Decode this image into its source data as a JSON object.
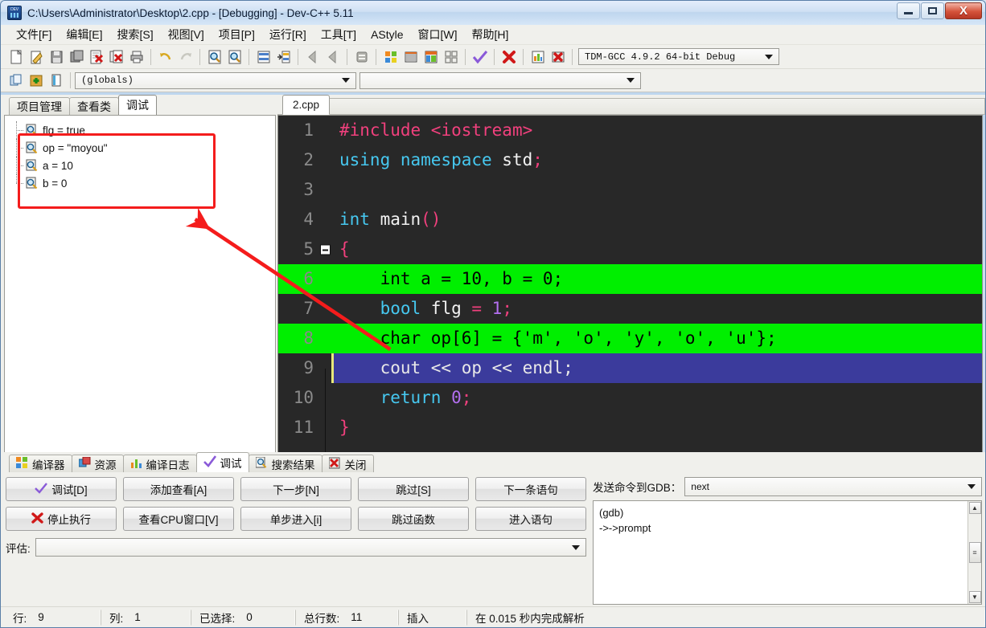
{
  "window": {
    "title": "C:\\Users\\Administrator\\Desktop\\2.cpp - [Debugging] - Dev-C++ 5.11",
    "minimize_label": "",
    "maximize_label": "",
    "close_label": "X"
  },
  "menubar": {
    "items": [
      {
        "label": "文件[F]"
      },
      {
        "label": "编辑[E]"
      },
      {
        "label": "搜索[S]"
      },
      {
        "label": "视图[V]"
      },
      {
        "label": "项目[P]"
      },
      {
        "label": "运行[R]"
      },
      {
        "label": "工具[T]"
      },
      {
        "label": "AStyle"
      },
      {
        "label": "窗口[W]"
      },
      {
        "label": "帮助[H]"
      }
    ]
  },
  "toolbar": {
    "compiler_combo": "TDM-GCC 4.9.2 64-bit Debug",
    "scope_combo": "(globals)",
    "symbol_combo": "",
    "icons": [
      "new-file-icon",
      "open-file-icon",
      "save-file-icon",
      "save-all-icon",
      "close-file-icon",
      "close-all-icon",
      "print-icon",
      "undo-icon",
      "redo-icon",
      "find-icon",
      "find-next-icon",
      "replace-icon",
      "goto-line-icon",
      "back-icon",
      "forward-icon",
      "toggle-icon",
      "compile-icon",
      "run-icon",
      "compile-run-icon",
      "rebuild-icon",
      "syntax-check-icon",
      "stop-icon",
      "profile-icon",
      "debug-stop-icon"
    ],
    "second_row_icons": [
      "project-new-icon",
      "project-add-icon",
      "project-view-icon"
    ]
  },
  "left_panel": {
    "tabs": [
      {
        "label": "项目管理",
        "active": false
      },
      {
        "label": "查看类",
        "active": false
      },
      {
        "label": "调试",
        "active": true
      }
    ],
    "watch_items": [
      {
        "icon": "watch-icon",
        "label": "flg = true"
      },
      {
        "icon": "watch-icon",
        "label": "op = \"moyou\""
      },
      {
        "icon": "watch-icon",
        "label": "a = 10"
      },
      {
        "icon": "watch-icon",
        "label": "b = 0"
      }
    ],
    "annotation": {
      "box_color": "#f41c1c",
      "arrow_color": "#f41c1c"
    }
  },
  "editor": {
    "tab_label": "2.cpp",
    "background": "#282828",
    "lines": [
      {
        "num": "1",
        "highlight": "none",
        "marker": "none",
        "fold": "none",
        "tokens": [
          {
            "t": "#include ",
            "c": "pre"
          },
          {
            "t": "<iostream>",
            "c": "pre"
          }
        ]
      },
      {
        "num": "2",
        "highlight": "none",
        "marker": "none",
        "fold": "none",
        "tokens": [
          {
            "t": "using namespace ",
            "c": "kw"
          },
          {
            "t": "std",
            "c": "id"
          },
          {
            "t": ";",
            "c": "punc"
          }
        ]
      },
      {
        "num": "3",
        "highlight": "none",
        "marker": "none",
        "fold": "none",
        "tokens": []
      },
      {
        "num": "4",
        "highlight": "none",
        "marker": "none",
        "fold": "none",
        "tokens": [
          {
            "t": "int ",
            "c": "kw"
          },
          {
            "t": "main",
            "c": "id"
          },
          {
            "t": "()",
            "c": "punc"
          }
        ]
      },
      {
        "num": "5",
        "highlight": "none",
        "marker": "none",
        "fold": "box",
        "tokens": [
          {
            "t": "{",
            "c": "punc"
          }
        ]
      },
      {
        "num": "6",
        "highlight": "green",
        "marker": "breakpoint",
        "fold": "line",
        "tokens": [
          {
            "t": "    int a = 10, b = 0;",
            "c": "plain"
          }
        ]
      },
      {
        "num": "7",
        "highlight": "none",
        "marker": "none",
        "fold": "line",
        "tokens": [
          {
            "t": "    ",
            "c": "plain"
          },
          {
            "t": "bool ",
            "c": "kw"
          },
          {
            "t": "flg ",
            "c": "id"
          },
          {
            "t": "= ",
            "c": "punc"
          },
          {
            "t": "1",
            "c": "num"
          },
          {
            "t": ";",
            "c": "punc"
          }
        ]
      },
      {
        "num": "8",
        "highlight": "green",
        "marker": "breakpoint",
        "fold": "line",
        "tokens": [
          {
            "t": "    char op[6] = {'m', 'o', 'y', 'o', 'u'};",
            "c": "plain"
          }
        ]
      },
      {
        "num": "9",
        "highlight": "current",
        "marker": "current-line",
        "fold": "line",
        "tokens": [
          {
            "t": "    cout << op << endl;",
            "c": "plain"
          }
        ]
      },
      {
        "num": "10",
        "highlight": "none",
        "marker": "none",
        "fold": "line",
        "tokens": [
          {
            "t": "    ",
            "c": "plain"
          },
          {
            "t": "return ",
            "c": "kw"
          },
          {
            "t": "0",
            "c": "num"
          },
          {
            "t": ";",
            "c": "punc"
          }
        ]
      },
      {
        "num": "11",
        "highlight": "none",
        "marker": "none",
        "fold": "end",
        "tokens": [
          {
            "t": "}",
            "c": "punc"
          }
        ]
      }
    ]
  },
  "bottom_panel": {
    "tabs": [
      {
        "label": "编译器",
        "icon": "compiler-icon",
        "active": false
      },
      {
        "label": "资源",
        "icon": "resource-icon",
        "active": false
      },
      {
        "label": "编译日志",
        "icon": "log-icon",
        "active": false
      },
      {
        "label": "调试",
        "icon": "check-icon",
        "active": true
      },
      {
        "label": "搜索结果",
        "icon": "search-icon",
        "active": false
      },
      {
        "label": "关闭",
        "icon": "close-panel-icon",
        "active": false
      }
    ],
    "debug_buttons_row1": [
      {
        "label": "调试[D]",
        "icon": "check-icon"
      },
      {
        "label": "添加查看[A]",
        "icon": "none"
      },
      {
        "label": "下一步[N]",
        "icon": "none"
      },
      {
        "label": "跳过[S]",
        "icon": "none"
      },
      {
        "label": "下一条语句",
        "icon": "none"
      }
    ],
    "debug_buttons_row2": [
      {
        "label": "停止执行",
        "icon": "stop-icon"
      },
      {
        "label": "查看CPU窗口[V]",
        "icon": "none"
      },
      {
        "label": "单步进入[i]",
        "icon": "none"
      },
      {
        "label": "跳过函数",
        "icon": "none"
      },
      {
        "label": "进入语句",
        "icon": "none"
      }
    ],
    "eval": {
      "label": "评估:",
      "value": ""
    },
    "gdb": {
      "label": "发送命令到GDB：",
      "command_value": "next",
      "output_lines": [
        "(gdb)",
        "->->prompt"
      ]
    }
  },
  "statusbar": {
    "cells": [
      {
        "label": "行:",
        "value": "9"
      },
      {
        "label": "列:",
        "value": "1"
      },
      {
        "label": "已选择:",
        "value": "0"
      },
      {
        "label": "总行数:",
        "value": "11"
      },
      {
        "label": "插入",
        "value": ""
      },
      {
        "label": "在 0.015 秒内完成解析",
        "value": ""
      }
    ]
  }
}
